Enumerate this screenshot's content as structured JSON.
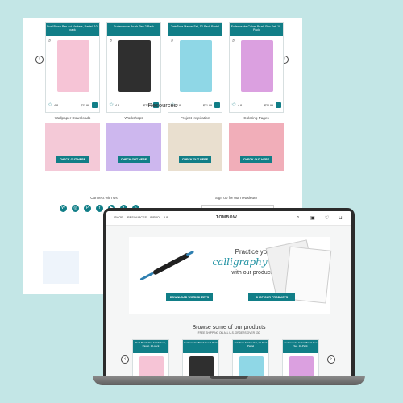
{
  "background_page": {
    "products": [
      {
        "title": "Dual Brush Pen Art Markers, Pastel, 10-pack",
        "reviews": "4.8",
        "price": "$21.99",
        "img_color": "#f6c4d6"
      },
      {
        "title": "Fudenosuke Brush Pen 2-Pack",
        "reviews": "4.8",
        "price": "$7.19",
        "img_color": "#2f2f2f"
      },
      {
        "title": "TwinTone Marker Set, 12-Pack Pastel",
        "reviews": "4.8",
        "price": "$21.99",
        "img_color": "#8fd7e6"
      },
      {
        "title": "Fudenosuke Colors Brush Pen Set, 10-Pack",
        "reviews": "4.8",
        "price": "$20.99",
        "img_color": "#dba0e0"
      }
    ],
    "resources_title": "Resources",
    "resources": [
      {
        "label": "Wallpaper Downloads",
        "button": "CHECK OUT HERE",
        "color": "#f4c9d7"
      },
      {
        "label": "Workshops",
        "button": "CHECK OUT HERE",
        "color": "#cdb7ee"
      },
      {
        "label": "Project Inspiration",
        "button": "CHECK OUT HERE",
        "color": "#e9dfcf"
      },
      {
        "label": "Coloring Pages",
        "button": "CHECK OUT HERE",
        "color": "#f1aeb9"
      }
    ],
    "connect_label": "Connect with Us",
    "newsletter_label": "Sign up for our newsletter",
    "social_icons": [
      "wordpress-icon",
      "instagram-icon",
      "pinterest-icon",
      "facebook-icon",
      "youtube-icon",
      "twitter-icon",
      "tiktok-icon"
    ]
  },
  "laptop": {
    "nav": {
      "items": [
        "SHOP",
        "RESOURCES",
        "INSPO",
        "US"
      ],
      "logo": "TOMBOW",
      "icons": [
        "search-icon",
        "account-icon",
        "wishlist-icon",
        "cart-icon"
      ]
    },
    "hero": {
      "line1": "Practice your",
      "line2": "calligraphy skills",
      "line3": "with our products!",
      "button_left": "DOWNLOAD WORKSHEETS",
      "button_right": "SHOP OUR PRODUCTS"
    },
    "browse_title": "Browse some of our products",
    "shipping_note": "FREE SHIPPING ON ALL U.S. ORDERS OVER $30",
    "products": [
      {
        "title": "Dual Brush Pen Art Markers, Pastel, 10-pack",
        "img_color": "#f6c4d6"
      },
      {
        "title": "Fudenosuke Brush Pen 2-Pack",
        "img_color": "#2f2f2f"
      },
      {
        "title": "TwinTone Marker Set, 12-Pack Pastel",
        "img_color": "#8fd7e6"
      },
      {
        "title": "Fudenosuke Colors Brush Pen Set, 10-Pack",
        "img_color": "#dba0e0"
      }
    ]
  },
  "colors": {
    "background": "#c3e6e6",
    "accent": "#117e87"
  }
}
